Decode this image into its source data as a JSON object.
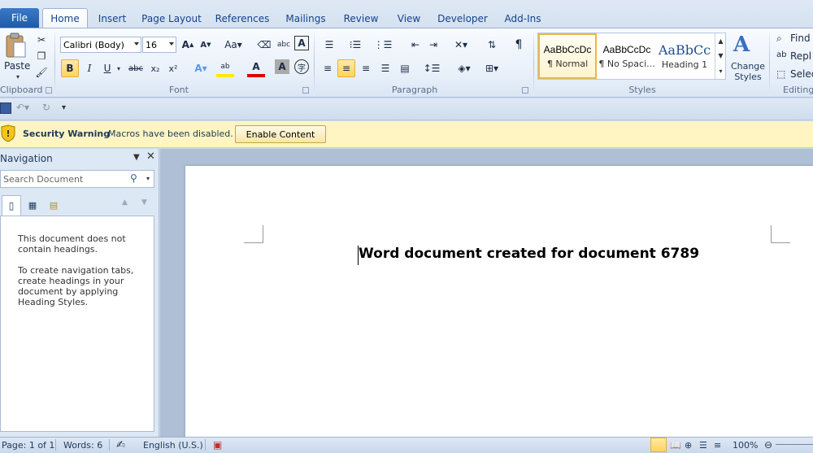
{
  "tabs": {
    "file": "File",
    "items": [
      "Home",
      "Insert",
      "Page Layout",
      "References",
      "Mailings",
      "Review",
      "View",
      "Developer",
      "Add-Ins"
    ]
  },
  "clipboard": {
    "paste": "Paste",
    "label": "Clipboard"
  },
  "font": {
    "name": "Calibri (Body)",
    "size": "16",
    "label": "Font",
    "bold": "B",
    "italic": "I",
    "underline": "U"
  },
  "paragraph": {
    "label": "Paragraph"
  },
  "styles": {
    "label": "Styles",
    "items": [
      {
        "preview": "AaBbCcDc",
        "name": "¶ Normal"
      },
      {
        "preview": "AaBbCcDc",
        "name": "¶ No Spaci..."
      },
      {
        "preview": "AaBbCc",
        "name": "Heading 1"
      }
    ],
    "change_styles": "Change Styles"
  },
  "editing": {
    "label": "Editing",
    "find": "Find",
    "replace": "Repl",
    "select": "Selec"
  },
  "warning": {
    "title": "Security Warning",
    "message": "Macros have been disabled.",
    "button": "Enable Content"
  },
  "navigation": {
    "title": "Navigation",
    "search_placeholder": "Search Document",
    "msg1": "This document does not contain headings.",
    "msg2": "To create navigation tabs, create headings in your document by applying Heading Styles."
  },
  "document": {
    "text": "Word document created for document 6789"
  },
  "status": {
    "page": "Page: 1 of 1",
    "words": "Words: 6",
    "language": "English (U.S.)",
    "zoom": "100%"
  },
  "colors": {
    "accent": "#1f5aa8",
    "highlight": "#ffd35c",
    "warning_bg": "#fff5c2"
  }
}
